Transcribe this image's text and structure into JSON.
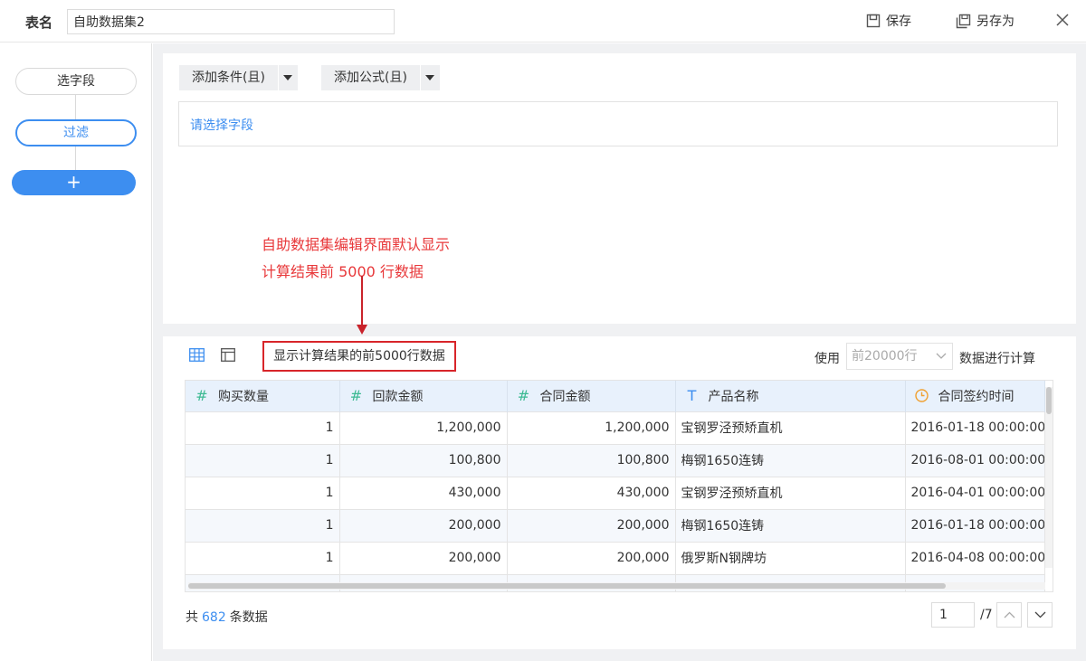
{
  "header": {
    "label": "表名",
    "table_name": "自助数据集2",
    "save_label": "保存",
    "save_as_label": "另存为"
  },
  "steps": {
    "select_fields": "选字段",
    "filter": "过滤",
    "add": "+"
  },
  "filter": {
    "add_condition": "添加条件(且)",
    "add_formula": "添加公式(且)",
    "field_placeholder": "请选择字段"
  },
  "annotation": {
    "line1": "自助数据集编辑界面默认显示",
    "line2": "计算结果前 5000 行数据"
  },
  "preview": {
    "hint": "显示计算结果的前5000行数据",
    "use_label": "使用",
    "use_value": "前20000行",
    "use_suffix": "数据进行计算"
  },
  "table": {
    "columns": [
      {
        "label": "购买数量",
        "icon": "#"
      },
      {
        "label": "回款金额",
        "icon": "#"
      },
      {
        "label": "合同金额",
        "icon": "#"
      },
      {
        "label": "产品名称",
        "icon": "T"
      },
      {
        "label": "合同签约时间",
        "icon": "clock"
      }
    ],
    "rows": [
      [
        "1",
        "1,200,000",
        "1,200,000",
        "宝钢罗泾预矫直机",
        "2016-01-18 00:00:00"
      ],
      [
        "1",
        "100,800",
        "100,800",
        "梅钢1650连铸",
        "2016-08-01 00:00:00"
      ],
      [
        "1",
        "430,000",
        "430,000",
        "宝钢罗泾预矫直机",
        "2016-04-01 00:00:00"
      ],
      [
        "1",
        "200,000",
        "200,000",
        "梅钢1650连铸",
        "2016-01-18 00:00:00"
      ],
      [
        "1",
        "200,000",
        "200,000",
        "俄罗斯N钢牌坊",
        "2016-04-08 00:00:00"
      ]
    ]
  },
  "footer": {
    "total_prefix": "共",
    "total_count": "682",
    "total_suffix": "条数据",
    "page_current": "1",
    "page_total": "/7"
  },
  "colors": {
    "accent": "#3d8ef0",
    "annotation": "#e8383a",
    "header_bg": "#e8f1fc"
  }
}
